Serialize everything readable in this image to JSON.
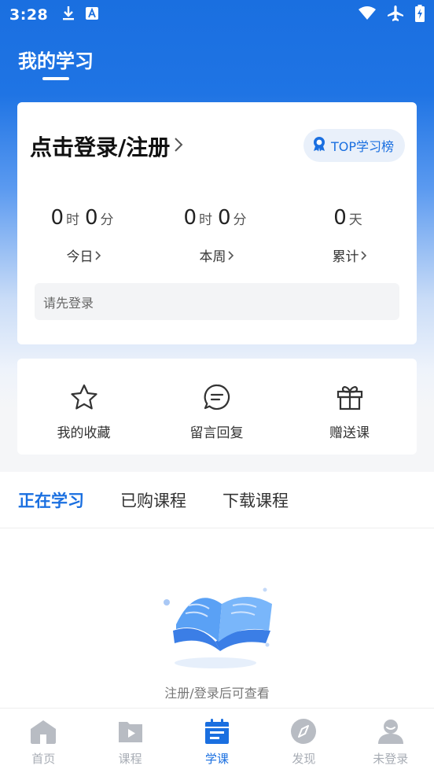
{
  "status_bar": {
    "time": "3:28"
  },
  "header": {
    "title": "我的学习"
  },
  "login_card": {
    "login_text": "点击登录/注册",
    "top_button": "TOP学习榜",
    "stats": [
      {
        "h": "0",
        "h_unit": "时",
        "m": "0",
        "m_unit": "分",
        "label": "今日"
      },
      {
        "h": "0",
        "h_unit": "时",
        "m": "0",
        "m_unit": "分",
        "label": "本周"
      },
      {
        "d": "0",
        "d_unit": "天",
        "label": "累计"
      }
    ],
    "notice": "请先登录"
  },
  "shortcuts": [
    {
      "label": "我的收藏",
      "icon": "star-icon"
    },
    {
      "label": "留言回复",
      "icon": "message-icon"
    },
    {
      "label": "赠送课",
      "icon": "gift-icon"
    }
  ],
  "tabs": [
    "正在学习",
    "已购课程",
    "下载课程"
  ],
  "active_tab": 0,
  "empty_text": "注册/登录后可查看",
  "bottom_nav": [
    {
      "label": "首页",
      "icon": "home-icon"
    },
    {
      "label": "课程",
      "icon": "course-icon"
    },
    {
      "label": "学课",
      "icon": "calendar-icon"
    },
    {
      "label": "发现",
      "icon": "compass-icon"
    },
    {
      "label": "未登录",
      "icon": "user-icon"
    }
  ],
  "active_nav": 2,
  "colors": {
    "primary": "#1a6fe0",
    "inactive": "#a8adb5"
  }
}
